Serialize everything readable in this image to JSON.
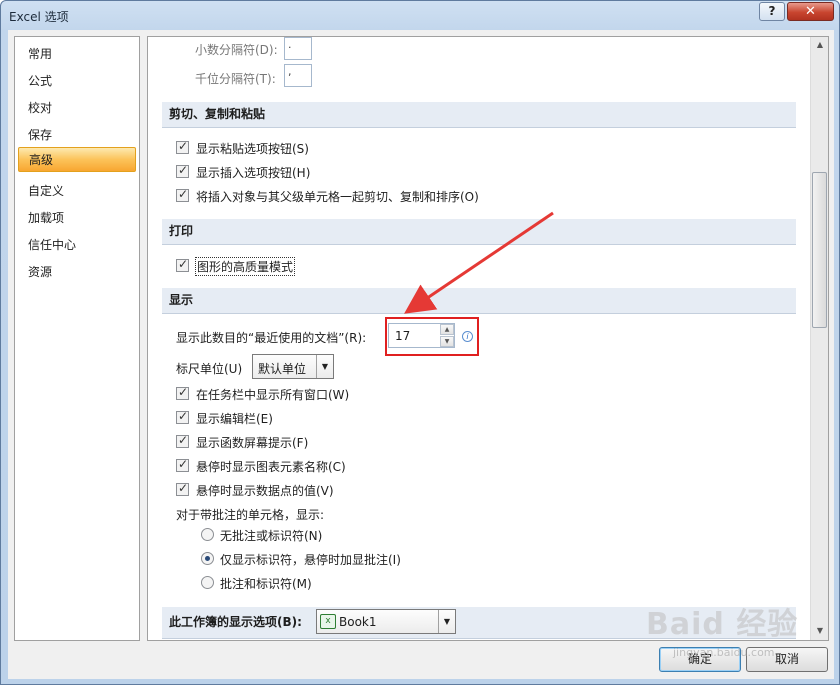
{
  "window": {
    "title": "Excel 选项",
    "help": "?",
    "close": "✕"
  },
  "sidebar": {
    "items": [
      {
        "label": "常用"
      },
      {
        "label": "公式"
      },
      {
        "label": "校对"
      },
      {
        "label": "保存"
      },
      {
        "label": "高级",
        "active": true
      },
      {
        "label": "自定义"
      },
      {
        "label": "加载项"
      },
      {
        "label": "信任中心"
      },
      {
        "label": "资源"
      }
    ]
  },
  "separators": {
    "decimal_label": "小数分隔符(D):",
    "decimal_value": ".",
    "thousands_label": "千位分隔符(T):",
    "thousands_value": ","
  },
  "cut_copy_paste": {
    "header": "剪切、复制和粘贴",
    "options": [
      {
        "label": "显示粘贴选项按钮(S)",
        "checked": true
      },
      {
        "label": "显示插入选项按钮(H)",
        "checked": true
      },
      {
        "label": "将插入对象与其父级单元格一起剪切、复制和排序(O)",
        "checked": true
      }
    ]
  },
  "print": {
    "header": "打印",
    "options": [
      {
        "label": "图形的高质量模式",
        "checked": true
      }
    ]
  },
  "display": {
    "header": "显示",
    "recent_docs_label": "显示此数目的“最近使用的文档”(R):",
    "recent_docs_value": "17",
    "ruler_label": "标尺单位(U)",
    "ruler_value": "默认单位",
    "options": [
      {
        "label": "在任务栏中显示所有窗口(W)",
        "checked": true
      },
      {
        "label": "显示编辑栏(E)",
        "checked": true
      },
      {
        "label": "显示函数屏幕提示(F)",
        "checked": true
      },
      {
        "label": "悬停时显示图表元素名称(C)",
        "checked": true
      },
      {
        "label": "悬停时显示数据点的值(V)",
        "checked": true
      }
    ],
    "comments_label": "对于带批注的单元格，显示:",
    "comment_options": [
      {
        "label": "无批注或标识符(N)",
        "selected": false
      },
      {
        "label": "仅显示标识符，悬停时加显批注(I)",
        "selected": true
      },
      {
        "label": "批注和标识符(M)",
        "selected": false
      }
    ]
  },
  "workbook_display": {
    "header": "此工作簿的显示选项(B):",
    "workbook": "Book1"
  },
  "buttons": {
    "ok": "确定",
    "cancel": "取消"
  },
  "watermark": {
    "main": "Baid 经验",
    "sub": "jingyan.baidu.com"
  },
  "colors": {
    "highlight": "#e02020",
    "active_item": "#fcc35a",
    "section_header": "#e6ecf4"
  }
}
